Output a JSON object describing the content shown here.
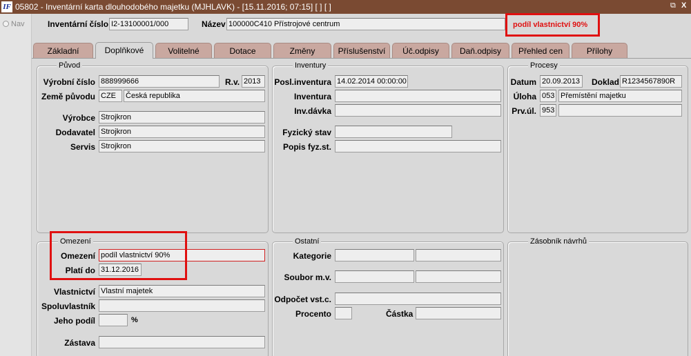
{
  "window": {
    "logo": "IF",
    "title": "05802 - Inventární karta dlouhodobého majetku (MJHLAVK) - [15.11.2016; 07:15]  [ ]  [ ]",
    "restore_glyph": "⧉",
    "close_glyph": "X"
  },
  "nav": {
    "label": "Nav"
  },
  "header": {
    "inv_label": "Inventární číslo",
    "inv_value": "I2-13100001/000",
    "name_label": "Název",
    "name_value": "100000C410 Přístrojové centrum",
    "warning": "podíl vlastnictví  90%"
  },
  "tabs": [
    "Základní",
    "Doplňkové",
    "Volitelné",
    "Dotace",
    "Změny",
    "Příslušenství",
    "Úč.odpisy",
    "Daň.odpisy",
    "Přehled cen",
    "Přílohy"
  ],
  "active_tab": "Doplňkové",
  "puvod": {
    "title": "Původ",
    "vyrobni_label": "Výrobní číslo",
    "vyrobni_value": "888999666",
    "rv_label": "R.v.",
    "rv_value": "2013",
    "zeme_label": "Země původu",
    "zeme_code": "CZE",
    "zeme_name": "Česká republika",
    "vyrobce_label": "Výrobce",
    "vyrobce_value": "Strojkron",
    "dodavatel_label": "Dodavatel",
    "dodavatel_value": "Strojkron",
    "servis_label": "Servis",
    "servis_value": "Strojkron"
  },
  "inventury": {
    "title": "Inventury",
    "posl_label": "Posl.inventura",
    "posl_value": "14.02.2014 00:00:00",
    "inventura_label": "Inventura",
    "inventura_value": "",
    "invdavka_label": "Inv.dávka",
    "invdavka_value": "",
    "fyz_label": "Fyzický stav",
    "fyz_value": "",
    "popis_label": "Popis fyz.st.",
    "popis_value": ""
  },
  "procesy": {
    "title": "Procesy",
    "datum_label": "Datum",
    "datum_value": "20.09.2013",
    "doklad_label": "Doklad",
    "doklad_value": "R1234567890R",
    "uloha_label": "Úloha",
    "uloha_code": "053",
    "uloha_name": "Přemístění majetku",
    "prvul_label": "Prv.úl.",
    "prvul_code": "953",
    "prvul_name": ""
  },
  "omezeni": {
    "title": "Omezení",
    "omezeni_label": "Omezení",
    "omezeni_value": "podíl vlastnictví  90%",
    "plati_label": "Platí do",
    "plati_value": "31.12.2016",
    "vlastnictvi_label": "Vlastnictví",
    "vlastnictvi_value": "Vlastní majetek",
    "spoluvlastnik_label": "Spoluvlastník",
    "spoluvlastnik_value": "",
    "podil_label": "Jeho podíl",
    "podil_value": "",
    "podil_unit": "%",
    "zastava_label": "Zástava",
    "zastava_value": ""
  },
  "ostatni": {
    "title": "Ostatní",
    "kategorie_label": "Kategorie",
    "soubor_label": "Soubor m.v.",
    "odpocet_label": "Odpočet vst.c.",
    "procento_label": "Procento",
    "castka_label": "Částka"
  },
  "zasobnik": {
    "title": "Zásobník návrhů"
  }
}
